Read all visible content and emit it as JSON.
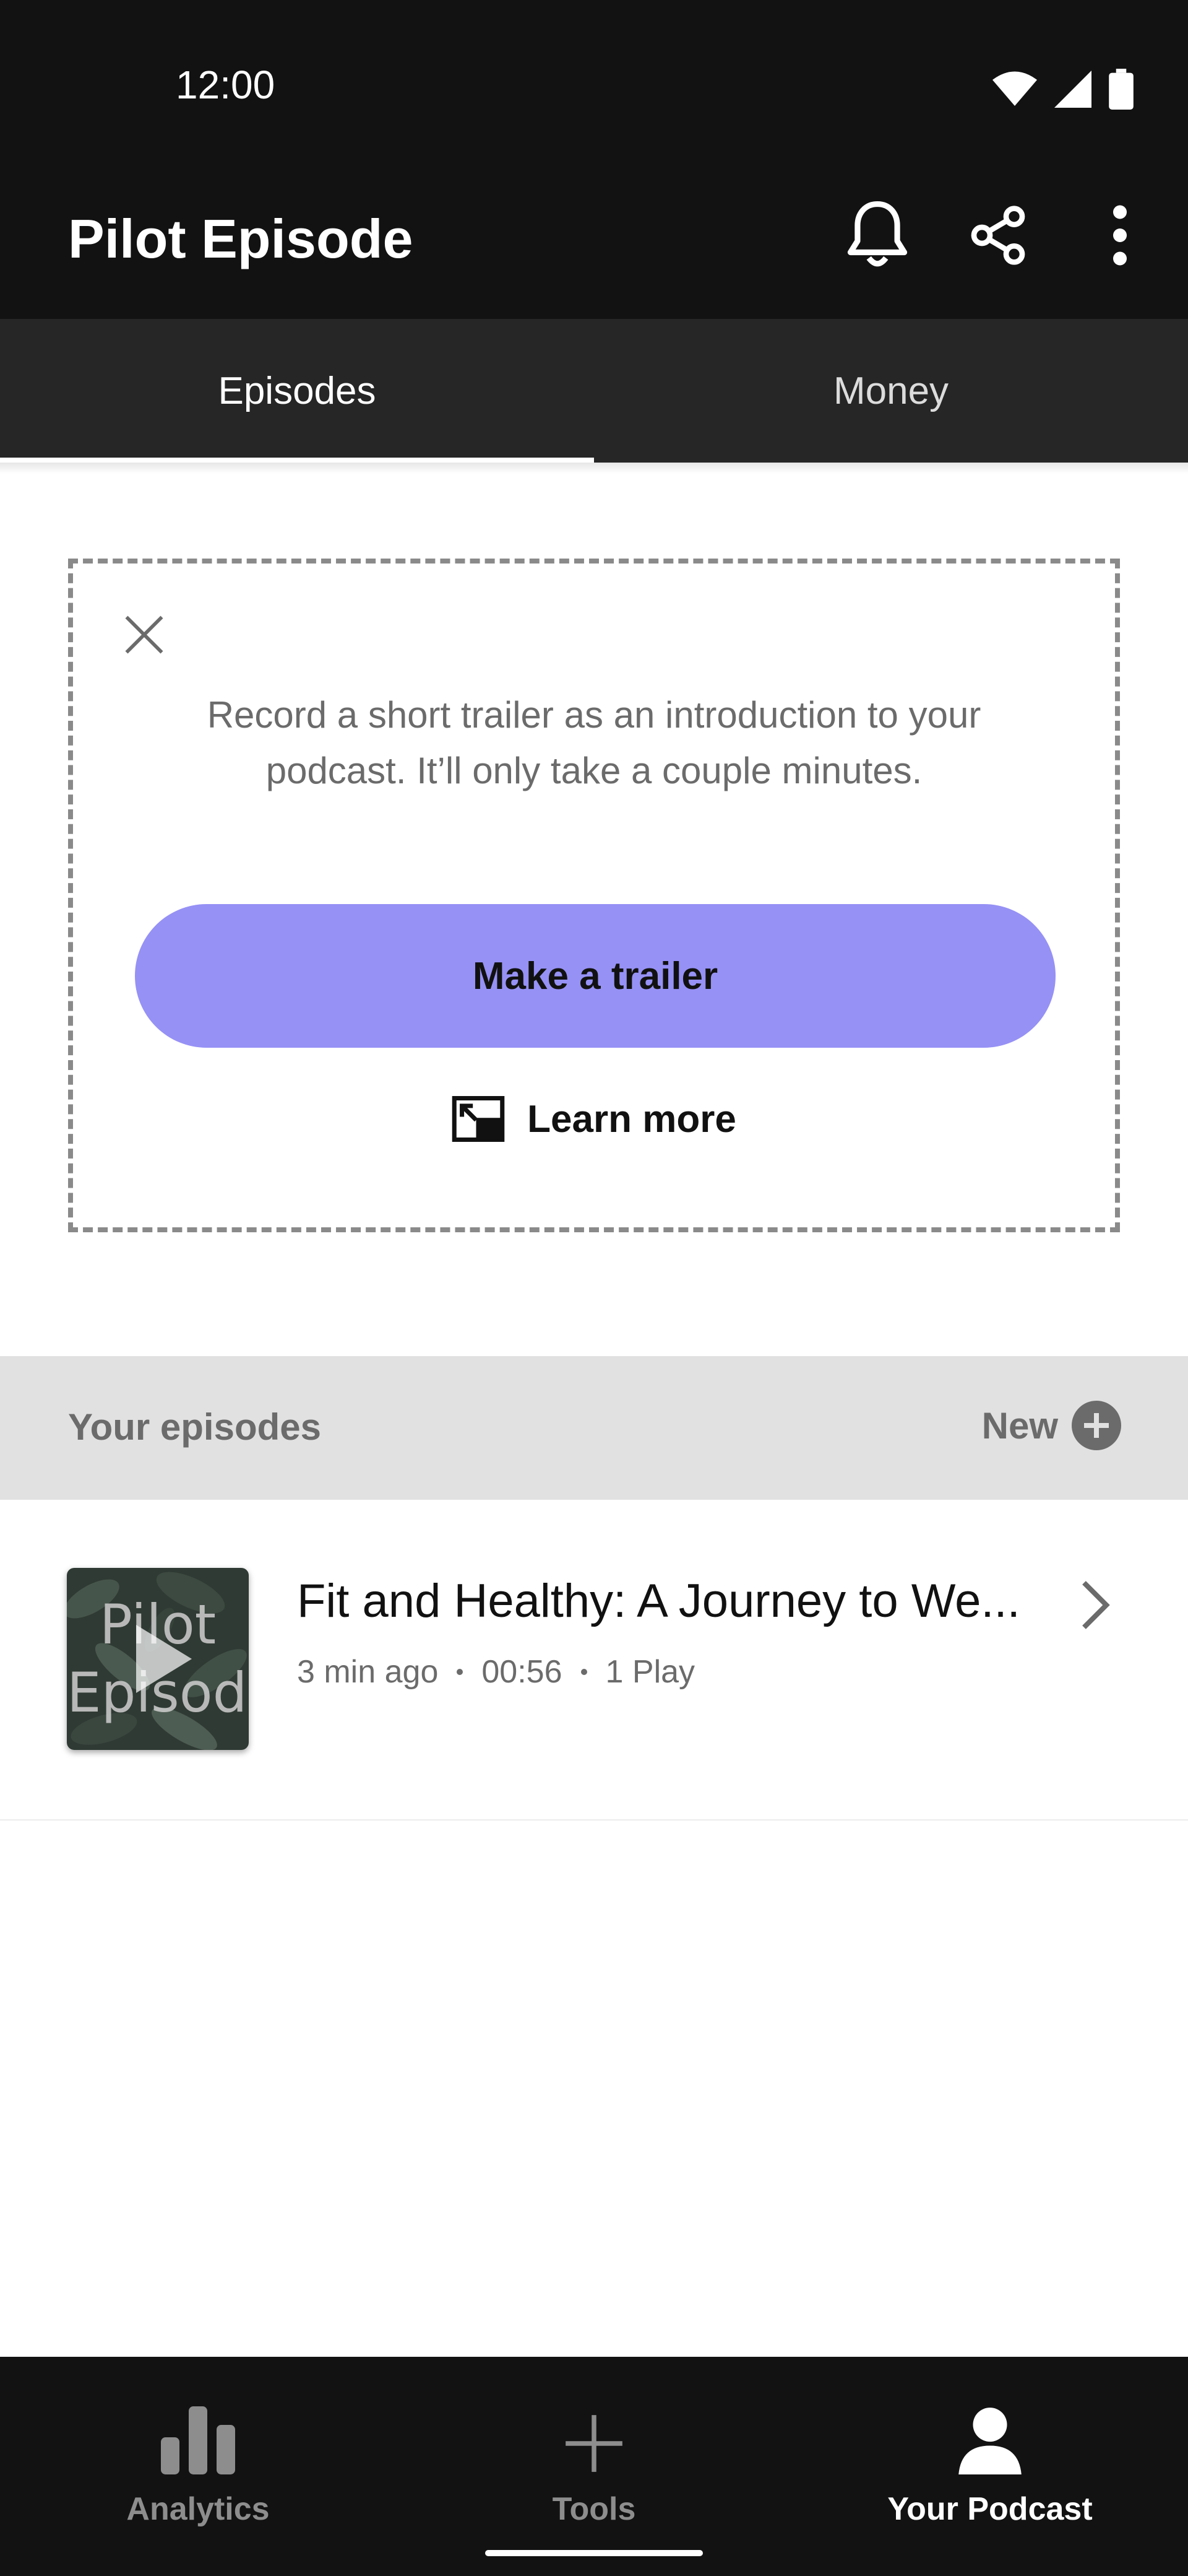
{
  "status_bar": {
    "time": "12:00"
  },
  "header": {
    "title": "Pilot Episode"
  },
  "tabs": [
    {
      "label": "Episodes",
      "active": true
    },
    {
      "label": "Money",
      "active": false
    }
  ],
  "promo": {
    "text": "Record a short trailer as an introduction to your podcast. It’ll only take a couple minutes.",
    "button_label": "Make a trailer",
    "learn_more_label": "Learn more"
  },
  "episodes_section": {
    "title": "Your episodes",
    "new_label": "New"
  },
  "episodes": [
    {
      "title": "Fit and Healthy: A Journey to We...",
      "posted": "3 min ago",
      "duration": "00:56",
      "plays": "1 Play",
      "thumbnail_text_line1": "Pilot",
      "thumbnail_text_line2": "Episode"
    }
  ],
  "bottom_nav": [
    {
      "label": "Analytics",
      "icon": "bar-chart-icon",
      "active": false
    },
    {
      "label": "Tools",
      "icon": "plus-icon",
      "active": false
    },
    {
      "label": "Your Podcast",
      "icon": "person-icon",
      "active": true
    }
  ],
  "colors": {
    "header_bg": "#121212",
    "tabs_bg": "#262626",
    "accent": "#9691f5",
    "section_bar_bg": "#e1e1e1"
  }
}
